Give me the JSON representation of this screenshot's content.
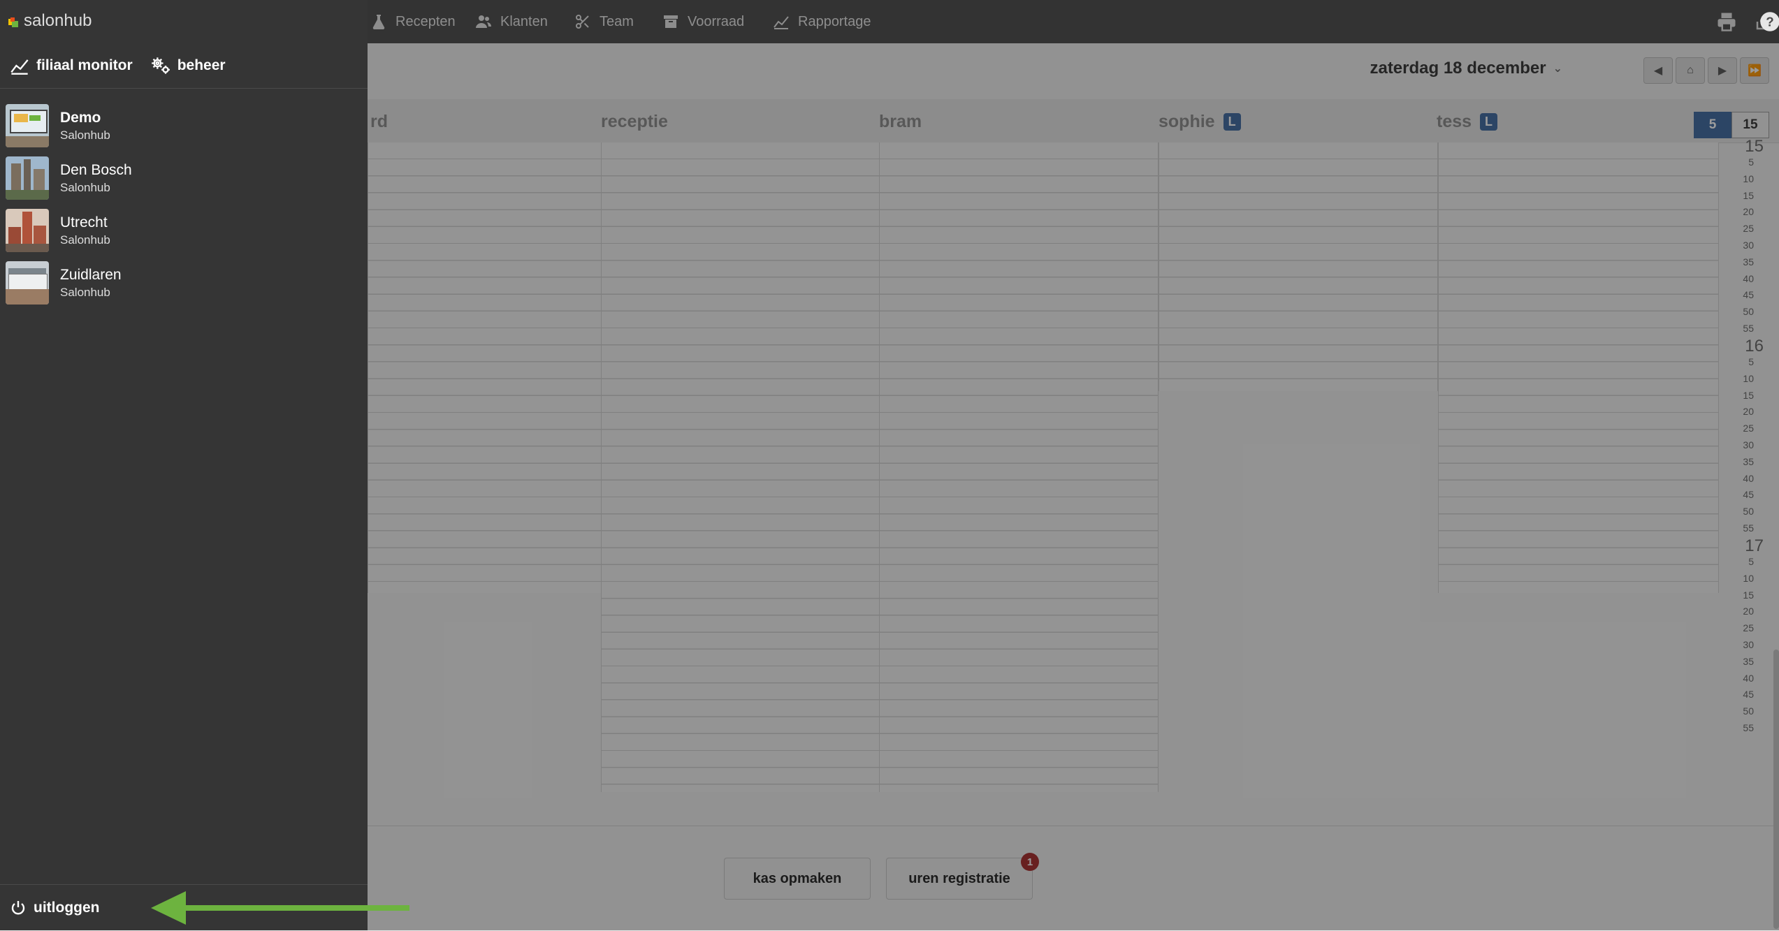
{
  "app": {
    "logo_text": "salonhub"
  },
  "top_nav": [
    {
      "label": "Recepten",
      "icon": "flask-icon"
    },
    {
      "label": "Klanten",
      "icon": "users-icon"
    },
    {
      "label": "Team",
      "icon": "scissors-icon"
    },
    {
      "label": "Voorraad",
      "icon": "archive-box-icon"
    },
    {
      "label": "Rapportage",
      "icon": "chart-line-icon"
    }
  ],
  "top_actions": [
    "print-icon",
    "share-icon",
    "help-icon"
  ],
  "calendar": {
    "date_label": "zaterdag 18 december",
    "nav_buttons": [
      "previous",
      "home",
      "next",
      "fast-forward"
    ],
    "partial_column_label": "rd",
    "columns": [
      {
        "name": "receptie",
        "badge": ""
      },
      {
        "name": "bram",
        "badge": ""
      },
      {
        "name": "sophie",
        "badge": "L"
      },
      {
        "name": "tess",
        "badge": "L"
      }
    ],
    "zoom_options": [
      "5",
      "15"
    ],
    "zoom_selected": "5",
    "time_labels": {
      "hours": [
        "15",
        "16",
        "17"
      ],
      "minutes": [
        "5",
        "10",
        "15",
        "20",
        "25",
        "30",
        "35",
        "40",
        "45",
        "50",
        "55"
      ]
    }
  },
  "footer": {
    "kas_button": "kas opmaken",
    "uren_button": "uren registratie",
    "uren_badge": "1"
  },
  "sidebar": {
    "filiaal_monitor": "filiaal monitor",
    "beheer": "beheer",
    "branches": [
      {
        "name": "Demo",
        "sub": "Salonhub",
        "active": true
      },
      {
        "name": "Den Bosch",
        "sub": "Salonhub",
        "active": false
      },
      {
        "name": "Utrecht",
        "sub": "Salonhub",
        "active": false
      },
      {
        "name": "Zuidlaren",
        "sub": "Salonhub",
        "active": false
      }
    ],
    "logout": "uitloggen"
  },
  "colors": {
    "accent_blue": "#3e6aa0",
    "sidebar_bg": "#353535",
    "topbar_bg": "#4a4a4a",
    "badge_red": "#a52a2a",
    "arrow_green": "#6db33f"
  }
}
